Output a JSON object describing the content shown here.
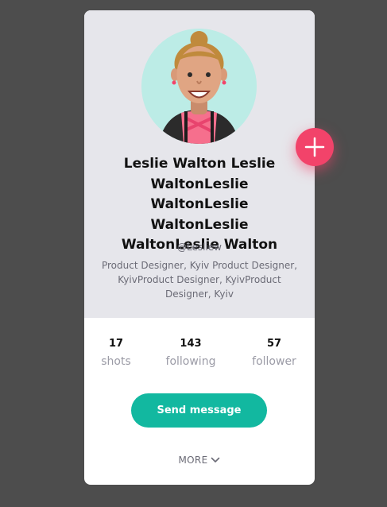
{
  "profile": {
    "name": "Leslie Walton Leslie WaltonLeslie WaltonLeslie WaltonLeslie WaltonLeslie Walton",
    "handle": "@Lesliew",
    "bio": "Product Designer, Kyiv Product Designer, KyivProduct Designer, KyivProduct Designer, Kyiv",
    "avatar_icon": "avatar-illustration"
  },
  "stats": [
    {
      "value": "17",
      "label": "shots"
    },
    {
      "value": "143",
      "label": "following"
    },
    {
      "value": "57",
      "label": "follower"
    }
  ],
  "actions": {
    "send_message_label": "Send message",
    "more_label": "MORE",
    "add_icon": "plus-icon",
    "more_icon": "chevron-down-icon"
  },
  "colors": {
    "page_background": "#4d4d4d",
    "card_header_background": "#e6e6eb",
    "accent_teal": "#12b8a0",
    "accent_pink": "#f2436a"
  }
}
